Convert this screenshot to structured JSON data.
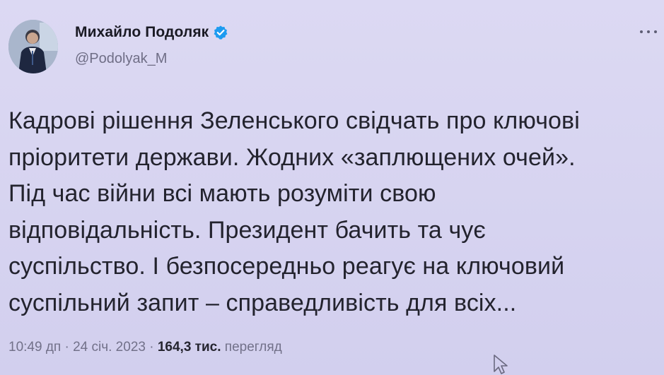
{
  "tweet": {
    "author": {
      "name": "Михайло Подоляк",
      "handle": "@Podolyak_M",
      "verified_icon": "verified-badge-icon"
    },
    "text": "Кадрові рішення Зеленського свідчать про ключові\nпріоритети держави. Жодних «заплющених очей».\nПід час війни всі мають розуміти свою\nвідповідальність. Президент бачить та чує\nсуспільство. І безпосередньо реагує на ключовий\nсуспільний запит – справедливість для всіх...",
    "meta": {
      "time": "10:49 дп",
      "separator1": " · ",
      "date": "24 січ. 2023",
      "separator2": " · ",
      "views_count": "164,3 тис.",
      "views_label": " перегляд"
    }
  },
  "colors": {
    "background": "#d9d6f2",
    "verified": "#1d9bf0",
    "text": "#23232e",
    "secondary": "#727189"
  }
}
